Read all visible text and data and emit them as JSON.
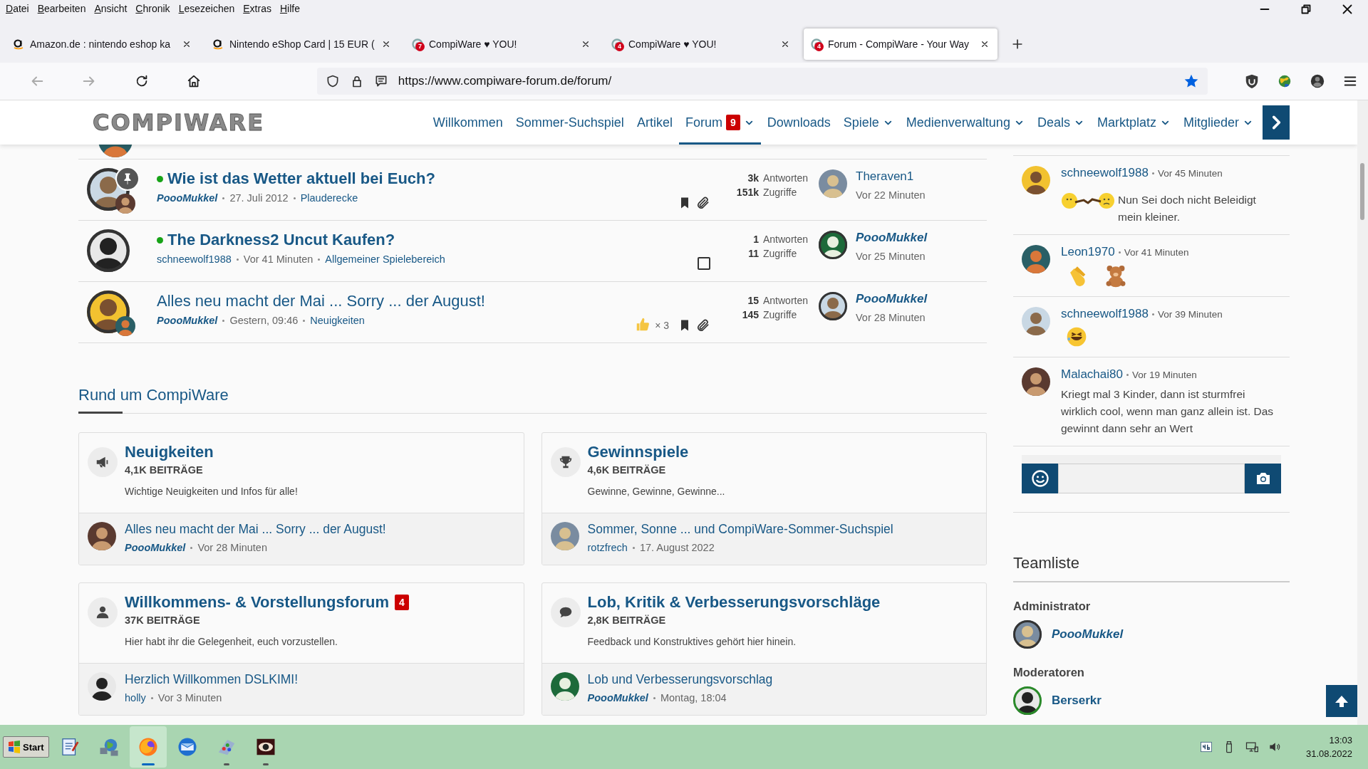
{
  "browser": {
    "menu": [
      "Datei",
      "Bearbeiten",
      "Ansicht",
      "Chronik",
      "Lesezeichen",
      "Extras",
      "Hilfe"
    ],
    "tabs": [
      {
        "title": "Amazon.de : nintendo eshop ka",
        "kind": "shop",
        "selected": false
      },
      {
        "title": "Nintendo eShop Card | 15 EUR (",
        "kind": "shop",
        "selected": false
      },
      {
        "title": "CompiWare ♥ YOU!",
        "kind": "forum",
        "badge": "7",
        "selected": false
      },
      {
        "title": "CompiWare ♥ YOU!",
        "kind": "forum",
        "badge": "4",
        "selected": false
      },
      {
        "title": "Forum - CompiWare - Your Way",
        "kind": "forum",
        "badge": "4",
        "selected": true
      }
    ],
    "url": "https://www.compiware-forum.de/forum/",
    "bookmarked": true
  },
  "site": {
    "logo": "COMPIWARE",
    "nav": [
      {
        "label": "Willkommen",
        "selected": false,
        "dropdown": false
      },
      {
        "label": "Sommer-Suchspiel",
        "selected": false,
        "dropdown": false
      },
      {
        "label": "Artikel",
        "selected": false,
        "dropdown": false
      },
      {
        "label": "Forum",
        "badge": "9",
        "selected": true,
        "dropdown": true
      },
      {
        "label": "Downloads",
        "selected": false,
        "dropdown": false
      },
      {
        "label": "Spiele",
        "selected": false,
        "dropdown": true
      },
      {
        "label": "Medienverwaltung",
        "selected": false,
        "dropdown": true
      },
      {
        "label": "Deals",
        "selected": false,
        "dropdown": true
      },
      {
        "label": "Marktplatz",
        "selected": false,
        "dropdown": true
      },
      {
        "label": "Mitglieder",
        "selected": false,
        "dropdown": true
      }
    ]
  },
  "threads": [
    {
      "title": "Wie ist das Wetter aktuell bei Euch?",
      "unread": true,
      "pinned": true,
      "second_avatar": true,
      "author": "PoooMukkel",
      "author_staff": true,
      "date": "27. Juli 2012",
      "forum": "Plauderecke",
      "markers": [
        {
          "kind": "bookmark"
        },
        {
          "kind": "attachment"
        }
      ],
      "replies": "3k",
      "replies_label": "Antworten",
      "views": "151k",
      "views_label": "Zugriffe",
      "last_user": "Theraven1",
      "last_user_staff": false,
      "last_time": "Vor 22 Minuten"
    },
    {
      "title": "The Darkness2 Uncut Kaufen?",
      "unread": true,
      "pinned": false,
      "second_avatar": false,
      "author": "schneewolf1988",
      "author_staff": false,
      "date": "Vor 41 Minuten",
      "forum": "Allgemeiner Spielebereich",
      "markers": [
        {
          "kind": "checkbox",
          "checked": false
        }
      ],
      "replies": "1",
      "replies_label": "Antworten",
      "views": "11",
      "views_label": "Zugriffe",
      "last_user": "PoooMukkel",
      "last_user_staff": true,
      "last_time": "Vor 25 Minuten"
    },
    {
      "title": "Alles neu macht der Mai ... Sorry ... der August!",
      "unread": false,
      "pinned": false,
      "second_avatar": true,
      "author": "PoooMukkel",
      "author_staff": true,
      "date": "Gestern, 09:46",
      "forum": "Neuigkeiten",
      "markers": [
        {
          "kind": "likes",
          "count": "× 3"
        },
        {
          "kind": "bookmark"
        },
        {
          "kind": "attachment"
        }
      ],
      "replies": "15",
      "replies_label": "Antworten",
      "views": "145",
      "views_label": "Zugriffe",
      "last_user": "PoooMukkel",
      "last_user_staff": true,
      "last_time": "Vor 28 Minuten"
    }
  ],
  "section_title": "Rund um CompiWare",
  "forums": [
    {
      "title": "Neuigkeiten",
      "kind": "megaphone",
      "posts": "4,1K BEITRÄGE",
      "description": "Wichtige Neuigkeiten und Infos für alle!",
      "last_title": "Alles neu macht der Mai ... Sorry ... der August!",
      "last_user": "PoooMukkel",
      "last_user_staff": true,
      "last_time": "Vor 28 Minuten"
    },
    {
      "title": "Gewinnspiele",
      "kind": "trophy",
      "posts": "4,6K BEITRÄGE",
      "description": "Gewinne, Gewinne, Gewinne...",
      "last_title": "Sommer, Sonne ... und CompiWare-Sommer-Suchspiel",
      "last_user": "rotzfrech",
      "last_user_staff": false,
      "last_time": "17. August 2022"
    },
    {
      "title": "Willkommens- & Vorstellungsforum",
      "badge": "4",
      "kind": "user",
      "posts": "37K BEITRÄGE",
      "description": "Hier habt ihr die Gelegenheit, euch vorzustellen.",
      "last_title": "Herzlich Willkommen DSLKIMI!",
      "last_user": "holly",
      "last_user_staff": false,
      "last_time": "Vor 3 Minuten"
    },
    {
      "title": "Lob, Kritik & Verbesserungsvorschläge",
      "kind": "speech",
      "posts": "2,8K BEITRÄGE",
      "description": "Feedback und Konstruktives gehört hier hinein.",
      "last_title": "Lob und Verbesserungsvorschlag",
      "last_user": "PoooMukkel",
      "last_user_staff": true,
      "last_time": "Montag, 18:04"
    }
  ],
  "chat": [
    {
      "user": "schneewolf1988",
      "time": "Vor 45 Minuten",
      "emojis": [
        {
          "kind": "sulk"
        }
      ],
      "text": "Nun Sei doch nicht Beleidigt mein kleiner."
    },
    {
      "user": "Leon1970",
      "time": "Vor 41 Minuten",
      "emojis": [
        {
          "kind": "clap"
        },
        {
          "kind": "teddy"
        }
      ]
    },
    {
      "user": "schneewolf1988",
      "time": "Vor 39 Minuten",
      "emojis": [
        {
          "kind": "laugh"
        }
      ]
    },
    {
      "user": "Malachai80",
      "time": "Vor 19 Minuten",
      "text": "Kriegt mal 3 Kinder, dann ist sturmfrei wirklich cool, wenn man ganz allein ist. Das gewinnt dann sehr an Wert"
    }
  ],
  "team": {
    "title": "Teamliste",
    "groups": [
      {
        "title": "Administrator",
        "members": [
          {
            "name": "PoooMukkel",
            "staff": true
          }
        ]
      },
      {
        "title": "Moderatoren",
        "members": [
          {
            "name": "Berserkr",
            "staff": false
          }
        ]
      }
    ]
  },
  "taskbar": {
    "start": "Start",
    "apps": [
      {
        "kind": "notepad",
        "active": false,
        "running": false
      },
      {
        "kind": "network",
        "active": false,
        "running": false
      },
      {
        "kind": "firefox",
        "active": true,
        "running": true
      },
      {
        "kind": "mail",
        "active": false,
        "running": false
      },
      {
        "kind": "paint",
        "active": false,
        "running": true
      },
      {
        "kind": "viewer",
        "active": false,
        "running": true
      }
    ],
    "tray": [
      {
        "kind": "keyboard"
      },
      {
        "kind": "usb"
      },
      {
        "kind": "monitor"
      },
      {
        "kind": "volume"
      }
    ],
    "time": "13:03",
    "date": "31.08.2022"
  }
}
